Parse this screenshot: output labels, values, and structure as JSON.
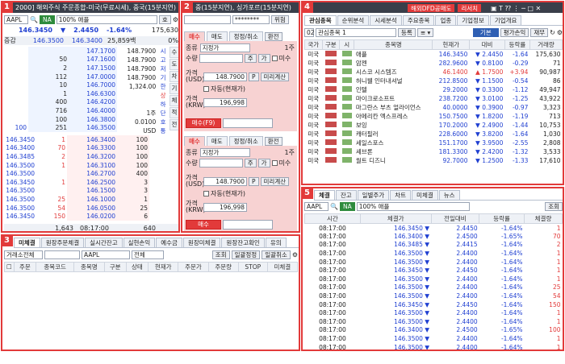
{
  "panel1": {
    "num": "1",
    "title": "2000] 해외주식 주문종합-미국(무료시세), 중국(15분지연)",
    "symbol": "AAPL",
    "exch": "NA",
    "name": "100% 애플",
    "side_btn": "호",
    "price": "146.3450",
    "chg": "2.4450",
    "pct": "-1.64%",
    "vol": "175,630",
    "sub_label": "증감",
    "bid_lbl": "146.3500",
    "ask_lbl": "146.3400",
    "qty_lbl": "25,859백",
    "pct2": "0%",
    "asks": [
      {
        "q": "",
        "p": "147.1700",
        "e": ""
      },
      {
        "q": "50",
        "p": "147.1600",
        "e": ""
      },
      {
        "q": "2",
        "p": "147.1500",
        "e": ""
      },
      {
        "q": "112",
        "p": "147.0000",
        "e": ""
      },
      {
        "q": "10",
        "p": "146.7000",
        "e": ""
      },
      {
        "q": "1",
        "p": "146.6300",
        "e": ""
      },
      {
        "q": "400",
        "p": "146.4200",
        "e": ""
      },
      {
        "q": "716",
        "p": "146.4000",
        "e": ""
      },
      {
        "q": "100",
        "p": "146.3800",
        "e": ""
      },
      {
        "q": "251",
        "p": "146.3500",
        "e": "100"
      }
    ],
    "info": [
      {
        "k": "148.7900",
        "v": "시"
      },
      {
        "k": "148.7900",
        "v": "고"
      },
      {
        "k": "148.7900",
        "v": "저"
      },
      {
        "k": "148.7900",
        "v": "기"
      },
      {
        "k": "1,324.00",
        "v": "한"
      },
      {
        "k": "",
        "v": "상"
      },
      {
        "k": "",
        "v": "하"
      },
      {
        "k": "1주",
        "v": "단"
      },
      {
        "k": "0.0100",
        "v": "호"
      },
      {
        "k": "USD",
        "v": "통"
      }
    ],
    "side_tabs": [
      "수",
      "도",
      "차",
      "기",
      "체",
      "적",
      "전"
    ],
    "bids": [
      {
        "q": "100",
        "p": "146.3400"
      },
      {
        "q": "100",
        "p": "146.3300"
      },
      {
        "q": "100",
        "p": "146.3200"
      },
      {
        "q": "100",
        "p": "146.3100"
      },
      {
        "q": "400",
        "p": "146.2700"
      },
      {
        "q": "3",
        "p": "146.2500"
      },
      {
        "q": "3",
        "p": "146.1500"
      },
      {
        "q": "1",
        "p": "146.1000"
      },
      {
        "q": "25",
        "p": "146.0500"
      },
      {
        "q": "6",
        "p": "146.0200"
      }
    ],
    "ticks": [
      {
        "p": "146.3450",
        "q": "1"
      },
      {
        "p": "146.3400",
        "q": "70"
      },
      {
        "p": "146.3485",
        "q": "2"
      },
      {
        "p": "146.3500",
        "q": "1"
      },
      {
        "p": "146.3500",
        "q": ""
      },
      {
        "p": "146.3450",
        "q": "1"
      },
      {
        "p": "146.3500",
        "q": ""
      },
      {
        "p": "146.3500",
        "q": "25"
      },
      {
        "p": "146.3500",
        "q": "54"
      },
      {
        "p": "146.3450",
        "q": "150"
      }
    ],
    "foot": {
      "a": "1,643",
      "b": "08:17:00",
      "c": "640"
    }
  },
  "panel2": {
    "num": "2",
    "title": "중(15분지연), 싱가포르(15분지연)",
    "pw": "********",
    "pw_btn": "위험",
    "tabs": [
      "매수",
      "매도",
      "정정/취소"
    ],
    "btn_hist": "환전",
    "top": {
      "type_lbl": "종류",
      "type_val": "지정가",
      "qty_lbl": "수량",
      "unit": "1주",
      "jugabtn": "주",
      "gabtn": "가",
      "misu": "미수",
      "price_lbl": "가격(USD)",
      "price_val": "148.7900",
      "p_btn": "P",
      "calc": "미리계산",
      "auto": "자동(현재가)",
      "krw_lbl": "가격(KRW)",
      "krw_val": "196,998",
      "buy": "매수(F9)"
    },
    "bot": {
      "type_lbl": "종류",
      "type_val": "지정가",
      "qty_lbl": "수량",
      "unit": "1주",
      "jugabtn": "주",
      "gabtn": "가",
      "misu": "미수",
      "price_lbl": "가격(USD)",
      "price_val": "148.7900",
      "p_btn": "P",
      "calc": "미리계산",
      "auto": "자동(현재가)",
      "krw_lbl": "가격(KRW)",
      "krw_val": "196,998",
      "buy": "매수"
    }
  },
  "panel3": {
    "num": "3",
    "tabs": [
      "미체결",
      "원장주문체결",
      "실시간잔고",
      "실현손익",
      "예수금",
      "원장미체결",
      "원장잔고확인",
      "유의"
    ],
    "filter_lbl": "거래소전체",
    "sym": "AAPL",
    "all": "전체",
    "q_btn": "조회",
    "b1": "일괄정정",
    "b2": "일괄취소",
    "cols": [
      "주문",
      "종목코드",
      "종목명",
      "구분",
      "상태",
      "현재가",
      "주문가",
      "주문량",
      "STOP",
      "미체결"
    ]
  },
  "panel4": {
    "num": "4",
    "top_btns": [
      "해외DFD공매도",
      "리서치"
    ],
    "tabs": [
      "관심종목",
      "순위분석",
      "시세분석",
      "주요종목",
      "업종",
      "기업정보",
      "기업개요"
    ],
    "group": "관심종목 1",
    "reg": "등록",
    "t1": "기본",
    "t2": "평가손익",
    "t3": "재무",
    "cols": [
      "국가",
      "구분",
      "시",
      "종목명",
      "현재가",
      "대비",
      "등락률",
      "거래량"
    ],
    "rows": [
      {
        "c": "미국",
        "n": "애플",
        "p": "146.3450",
        "d": "2.4450",
        "r": "-1.64",
        "v": "175,630",
        "s": "dn"
      },
      {
        "c": "미국",
        "n": "암젠",
        "p": "282.9600",
        "d": "0.8100",
        "r": "-0.29",
        "v": "71",
        "s": "dn"
      },
      {
        "c": "미국",
        "n": "시스코 시스템즈",
        "p": "46.1400",
        "d": "1.7500",
        "r": "+3.94",
        "v": "90,987",
        "s": "up"
      },
      {
        "c": "미국",
        "n": "허니웰 인터내셔널",
        "p": "212.8500",
        "d": "1.1500",
        "r": "-0.54",
        "v": "86",
        "s": "dn"
      },
      {
        "c": "미국",
        "n": "인텔",
        "p": "29.2000",
        "d": "0.3300",
        "r": "-1.12",
        "v": "49,947",
        "s": "dn"
      },
      {
        "c": "미국",
        "n": "마이크로소프트",
        "p": "238.7200",
        "d": "3.0100",
        "r": "-1.25",
        "v": "43,922",
        "s": "dn"
      },
      {
        "c": "미국",
        "n": "마그란스 부츠 얼라이언스",
        "p": "40.0000",
        "d": "0.3900",
        "r": "-0.97",
        "v": "3,323",
        "s": "dn"
      },
      {
        "c": "미국",
        "n": "아메리칸 엑스프레스",
        "p": "150.7500",
        "d": "1.8200",
        "r": "-1.19",
        "v": "713",
        "s": "dn"
      },
      {
        "c": "미국",
        "n": "보잉",
        "p": "170.2000",
        "d": "2.4900",
        "r": "-1.44",
        "v": "10,753",
        "s": "dn"
      },
      {
        "c": "미국",
        "n": "캐터필러",
        "p": "228.6000",
        "d": "3.8200",
        "r": "-1.64",
        "v": "1,030",
        "s": "dn"
      },
      {
        "c": "미국",
        "n": "세일스포스",
        "p": "151.1700",
        "d": "3.9500",
        "r": "-2.55",
        "v": "2,808",
        "s": "dn"
      },
      {
        "c": "미국",
        "n": "셰브론",
        "p": "181.3300",
        "d": "2.4200",
        "r": "-1.32",
        "v": "3,533",
        "s": "dn"
      },
      {
        "c": "미국",
        "n": "월트 디즈니",
        "p": "92.7000",
        "d": "1.2500",
        "r": "-1.33",
        "v": "17,610",
        "s": "dn"
      }
    ]
  },
  "panel5": {
    "num": "5",
    "tabs": [
      "체결",
      "잔고",
      "일별주가",
      "차트",
      "미체결",
      "뉴스"
    ],
    "sym": "AAPL",
    "name": "100% 애플",
    "q_btn": "조회",
    "cols": [
      "시간",
      "체결가",
      "전일대비",
      "등락률",
      "체결량"
    ],
    "rows": [
      {
        "t": "08:17:00",
        "p": "146.3450",
        "d": "2.4450",
        "r": "-1.64%",
        "q": "1"
      },
      {
        "t": "08:17:00",
        "p": "146.3400",
        "d": "2.4500",
        "r": "-1.65%",
        "q": "70"
      },
      {
        "t": "08:17:00",
        "p": "146.3485",
        "d": "2.4415",
        "r": "-1.64%",
        "q": "2"
      },
      {
        "t": "08:17:00",
        "p": "146.3500",
        "d": "2.4400",
        "r": "-1.64%",
        "q": "1"
      },
      {
        "t": "08:17:00",
        "p": "146.3500",
        "d": "2.4400",
        "r": "-1.64%",
        "q": "1"
      },
      {
        "t": "08:17:00",
        "p": "146.3450",
        "d": "2.4450",
        "r": "-1.64%",
        "q": "1"
      },
      {
        "t": "08:17:00",
        "p": "146.3500",
        "d": "2.4400",
        "r": "-1.64%",
        "q": "1"
      },
      {
        "t": "08:17:00",
        "p": "146.3500",
        "d": "2.4400",
        "r": "-1.64%",
        "q": "25"
      },
      {
        "t": "08:17:00",
        "p": "146.3500",
        "d": "2.4400",
        "r": "-1.64%",
        "q": "54"
      },
      {
        "t": "08:17:00",
        "p": "146.3450",
        "d": "2.4450",
        "r": "-1.64%",
        "q": "150"
      },
      {
        "t": "08:17:00",
        "p": "146.3500",
        "d": "2.4400",
        "r": "-1.64%",
        "q": "1"
      },
      {
        "t": "08:17:00",
        "p": "146.3500",
        "d": "2.4400",
        "r": "-1.64%",
        "q": "1"
      },
      {
        "t": "08:17:00",
        "p": "146.3400",
        "d": "2.4500",
        "r": "-1.65%",
        "q": "100"
      },
      {
        "t": "08:17:00",
        "p": "146.3500",
        "d": "2.4400",
        "r": "-1.64%",
        "q": "1"
      },
      {
        "t": "08:17:00",
        "p": "146.3500",
        "d": "2.4400",
        "r": "-1.64%",
        "q": "1"
      }
    ]
  },
  "colors": {
    "accent": "#e23a3a",
    "up": "#e23a3a",
    "down": "#1f3fd1",
    "order_bg": "#f7d2d2"
  }
}
